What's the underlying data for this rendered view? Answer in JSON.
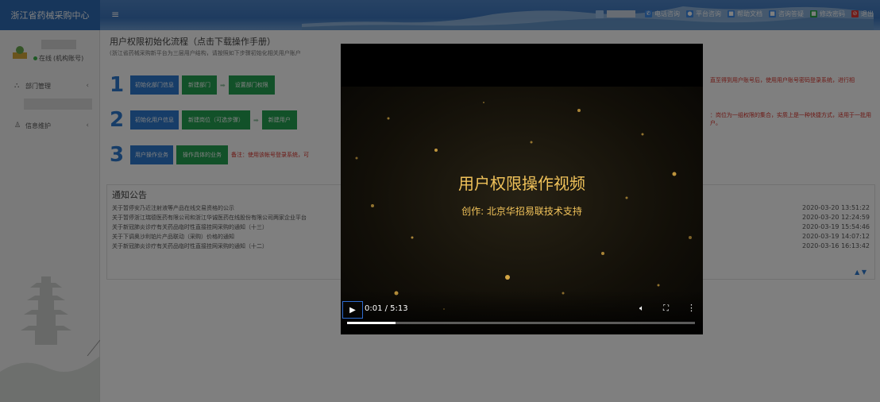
{
  "header": {
    "system_title": "浙江省药械采购中心",
    "menu_icon": "menu-icon",
    "links": [
      {
        "label": "电话咨询",
        "icon": "phone-icon",
        "color": "#3d8be8",
        "glyph": "✆"
      },
      {
        "label": "平台咨询",
        "icon": "chat-icon",
        "color": "#3d8be8",
        "glyph": "●"
      },
      {
        "label": "帮助文档",
        "icon": "doc-icon",
        "color": "#3d8be8",
        "glyph": "■"
      },
      {
        "label": "咨询答疑",
        "icon": "qa-icon",
        "color": "#3d8be8",
        "glyph": "■"
      },
      {
        "label": "修改密码",
        "icon": "key-icon",
        "color": "#29a84a",
        "glyph": "■"
      },
      {
        "label": "退出",
        "icon": "logout-icon",
        "color": "#e53935",
        "glyph": "⊘"
      }
    ]
  },
  "sidebar": {
    "status_online": "在线",
    "status_account": "(机构账号)",
    "items": [
      {
        "label": "部门管理",
        "icon": "org-icon"
      },
      {
        "label": "信息维护",
        "icon": "user-info-icon"
      }
    ]
  },
  "main": {
    "title": "用户权限初始化流程（点击下载操作手册）",
    "subtitle": "(浙江省药械采购新平台为三层用户结构，请按照如下步骤初始化相关用户账户",
    "steps": [
      {
        "number": "1",
        "first": "初始化部门信息",
        "buttons": [
          "新建部门",
          "设置部门权限"
        ],
        "note": "",
        "right_note": "直至得到用户账号后，使用用户账号密码登录系统，进行相"
      },
      {
        "number": "2",
        "first": "初始化用户信息",
        "buttons": [
          "新建岗位（可选步骤）",
          "新建用户"
        ],
        "note": "",
        "right_note": "：岗位为一组权限的集合，实质上是一种快捷方式，适用于一批用户。"
      },
      {
        "number": "3",
        "first": "用户操作业务",
        "buttons": [
          "操作具体的业务"
        ],
        "note": "备注：使用该帐号登录系统，可",
        "right_note": ""
      }
    ],
    "notice": {
      "title": "通知公告",
      "rows": [
        {
          "text": "关于暂停安乃近注射液等产品在线交易资格的公示",
          "date": "2020-03-20 13:51:22"
        },
        {
          "text": "关于暂停浙江瑞德医药有限公司和浙江华诚医药在线股份有限公司两家企业平台",
          "date": "2020-03-20 12:24:59"
        },
        {
          "text": "关于新冠肺炎诊疗有关药品临时性直接挂网采购的通知（十三）",
          "date": "2020-03-19 15:54:46"
        },
        {
          "text": "关于下调奥沙利铂片产品联动（采购）价格的通知",
          "date": "2020-03-19 14:07:12"
        },
        {
          "text": "关于新冠肺炎诊疗有关药品临时性直接挂网采购的通知（十二）",
          "date": "2020-03-16 16:13:42"
        }
      ],
      "pager": "▲ ▼"
    }
  },
  "video": {
    "title": "用户权限操作视频",
    "subtitle": "创作: 北京华招易联技术支持",
    "time": "0:01 / 5:13",
    "progress_fraction": 0.14,
    "play_icon": "play-icon",
    "volume_icon": "volume-icon",
    "fullscreen_icon": "fullscreen-icon",
    "more_icon": "more-vertical-icon"
  }
}
